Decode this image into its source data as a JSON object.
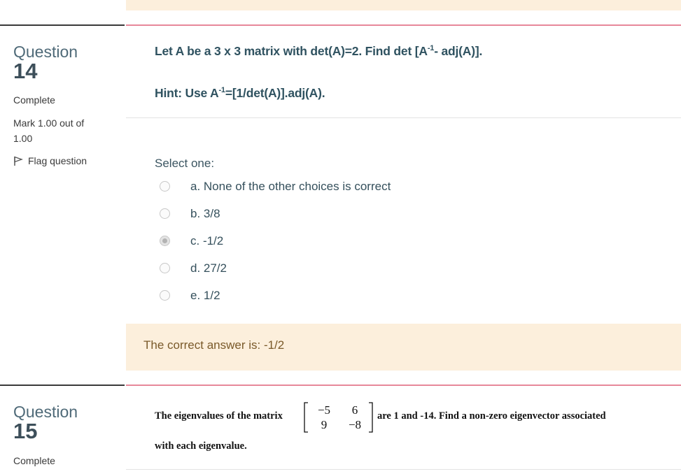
{
  "q14": {
    "word": "Question",
    "number": "14",
    "state": "Complete",
    "grade": "Mark 1.00 out of 1.00",
    "flag_label": "Flag question",
    "text_main": "Let A be a 3 x 3 matrix with det(A)=2. Find det [A",
    "text_sup": "-1",
    "text_tail": "- adj(A)].",
    "hint_pre": "Hint: Use A",
    "hint_sup": "-1",
    "hint_tail": "=[1/det(A)].adj(A).",
    "select_one": "Select one:",
    "options": [
      {
        "label": "a. None of the other choices is correct",
        "checked": false
      },
      {
        "label": "b. 3/8",
        "checked": false
      },
      {
        "label": "c. -1/2",
        "checked": true
      },
      {
        "label": "d. 27/2",
        "checked": false
      },
      {
        "label": "e. 1/2",
        "checked": false
      }
    ],
    "feedback": "The correct answer is: -1/2"
  },
  "q15": {
    "word": "Question",
    "number": "15",
    "state": "Complete",
    "text_pre": "The eigenvalues of the matrix",
    "text_post": "are 1 and -14. Find a non-zero eigenvector associated",
    "text_line2": "with each eigenvalue.",
    "matrix": [
      [
        "−5",
        "6"
      ],
      [
        "9",
        "−8"
      ]
    ]
  },
  "colors": {
    "accent_pink": "#e7889a",
    "feedback_bg": "#fcefdc",
    "question_text": "#2f5260"
  }
}
